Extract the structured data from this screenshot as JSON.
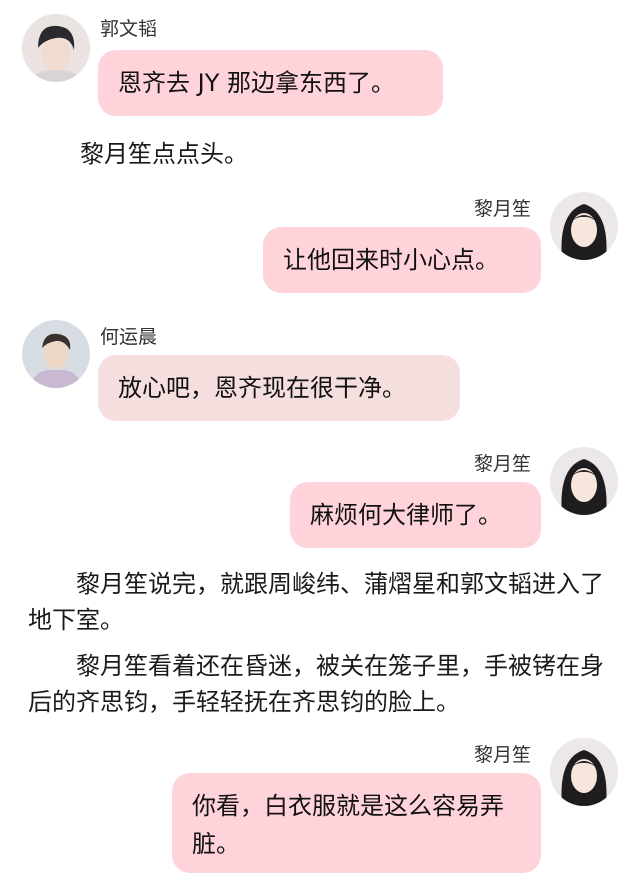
{
  "messages": [
    {
      "sender": "郭文韬",
      "text": "恩齐去 JY 那边拿东西了。"
    },
    {
      "sender": "黎月笙",
      "text": "让他回来时小心点。"
    },
    {
      "sender": "何运晨",
      "text": "放心吧，恩齐现在很干净。"
    },
    {
      "sender": "黎月笙",
      "text": "麻烦何大律师了。"
    },
    {
      "sender": "黎月笙",
      "text": "你看，白衣服就是这么容易弄脏。"
    }
  ],
  "narration": [
    "黎月笙点点头。",
    "黎月笙说完，就跟周峻纬、蒲熠星和郭文韬进入了地下室。",
    "黎月笙看着还在昏迷，被关在笼子里，手被铐在身后的齐思钧，手轻轻抚在齐思钧的脸上。"
  ],
  "colors": {
    "bubble_pink": "#ffd3da",
    "bubble_gray": "#f5dede"
  }
}
